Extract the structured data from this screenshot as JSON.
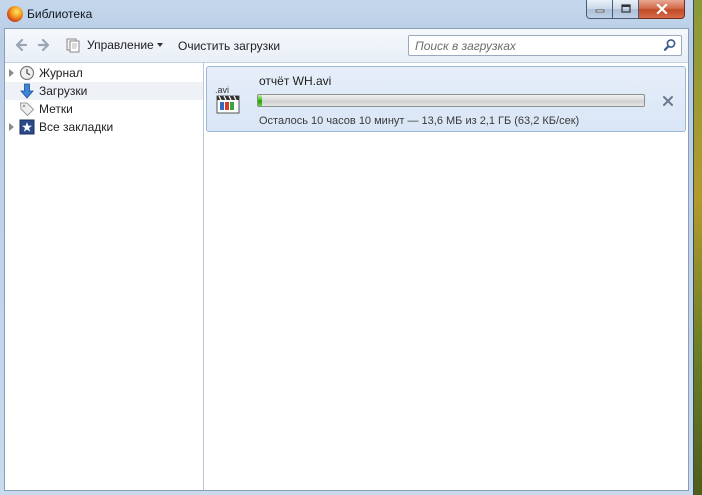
{
  "window": {
    "title": "Библиотека"
  },
  "toolbar": {
    "organize_label": "Управление",
    "clear_label": "Очистить загрузки",
    "search_placeholder": "Поиск в загрузках"
  },
  "sidebar": {
    "items": [
      {
        "label": "Журнал",
        "icon": "clock-icon",
        "expandable": true
      },
      {
        "label": "Загрузки",
        "icon": "download-arrow-icon",
        "expandable": false,
        "selected": true
      },
      {
        "label": "Метки",
        "icon": "tag-icon",
        "expandable": false
      },
      {
        "label": "Все закладки",
        "icon": "star-icon",
        "expandable": true
      }
    ]
  },
  "downloads": [
    {
      "file_ext": ".avi",
      "file_name": "отчёт WH.avi",
      "progress_fraction": 0.006,
      "status": "Осталось 10 часов 10 минут — 13,6 МБ из 2,1 ГБ (63,2 КБ/сек)"
    }
  ],
  "colors": {
    "accent": "#3fc21b",
    "selection": "#d9e6f6"
  }
}
